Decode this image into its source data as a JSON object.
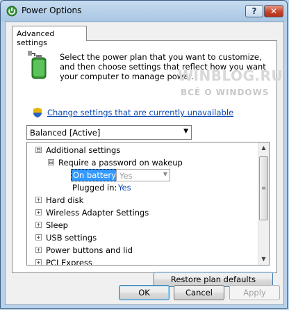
{
  "window": {
    "title": "Power Options"
  },
  "titlebar": {
    "help_label": "?",
    "close_label": "✕"
  },
  "tabs": [
    {
      "label": "Advanced settings"
    }
  ],
  "intro": {
    "text": "Select the power plan that you want to customize, and then choose settings that reflect how you want your computer to manage power."
  },
  "watermark": {
    "line1": "WINBLOG.RU",
    "line2": "ВСЁ О WINDOWS"
  },
  "change_link": {
    "label": "Change settings that are currently unavailable"
  },
  "plan_select": {
    "value": "Balanced [Active]"
  },
  "tree": {
    "additional_settings": {
      "label": "Additional settings",
      "expander": "⊟"
    },
    "require_password": {
      "label": "Require a password on wakeup",
      "expander": "⊟"
    },
    "on_battery": {
      "label": "On battery:",
      "value": "Yes"
    },
    "plugged_in": {
      "label": "Plugged in:",
      "value": "Yes"
    },
    "items": [
      {
        "label": "Hard disk"
      },
      {
        "label": "Wireless Adapter Settings"
      },
      {
        "label": "Sleep"
      },
      {
        "label": "USB settings"
      },
      {
        "label": "Power buttons and lid"
      },
      {
        "label": "PCI Express"
      }
    ],
    "collapsed_expander": "+"
  },
  "buttons": {
    "restore": "Restore plan defaults",
    "ok": "OK",
    "cancel": "Cancel",
    "apply": "Apply"
  },
  "colors": {
    "link": "#0645ad",
    "selection": "#3399ff",
    "title_bg": "#a9c6e3",
    "close_button": "#c5442b"
  },
  "icons": {
    "window": "power-options-icon",
    "plan": "battery-plug-icon",
    "shield": "uac-shield-icon"
  }
}
